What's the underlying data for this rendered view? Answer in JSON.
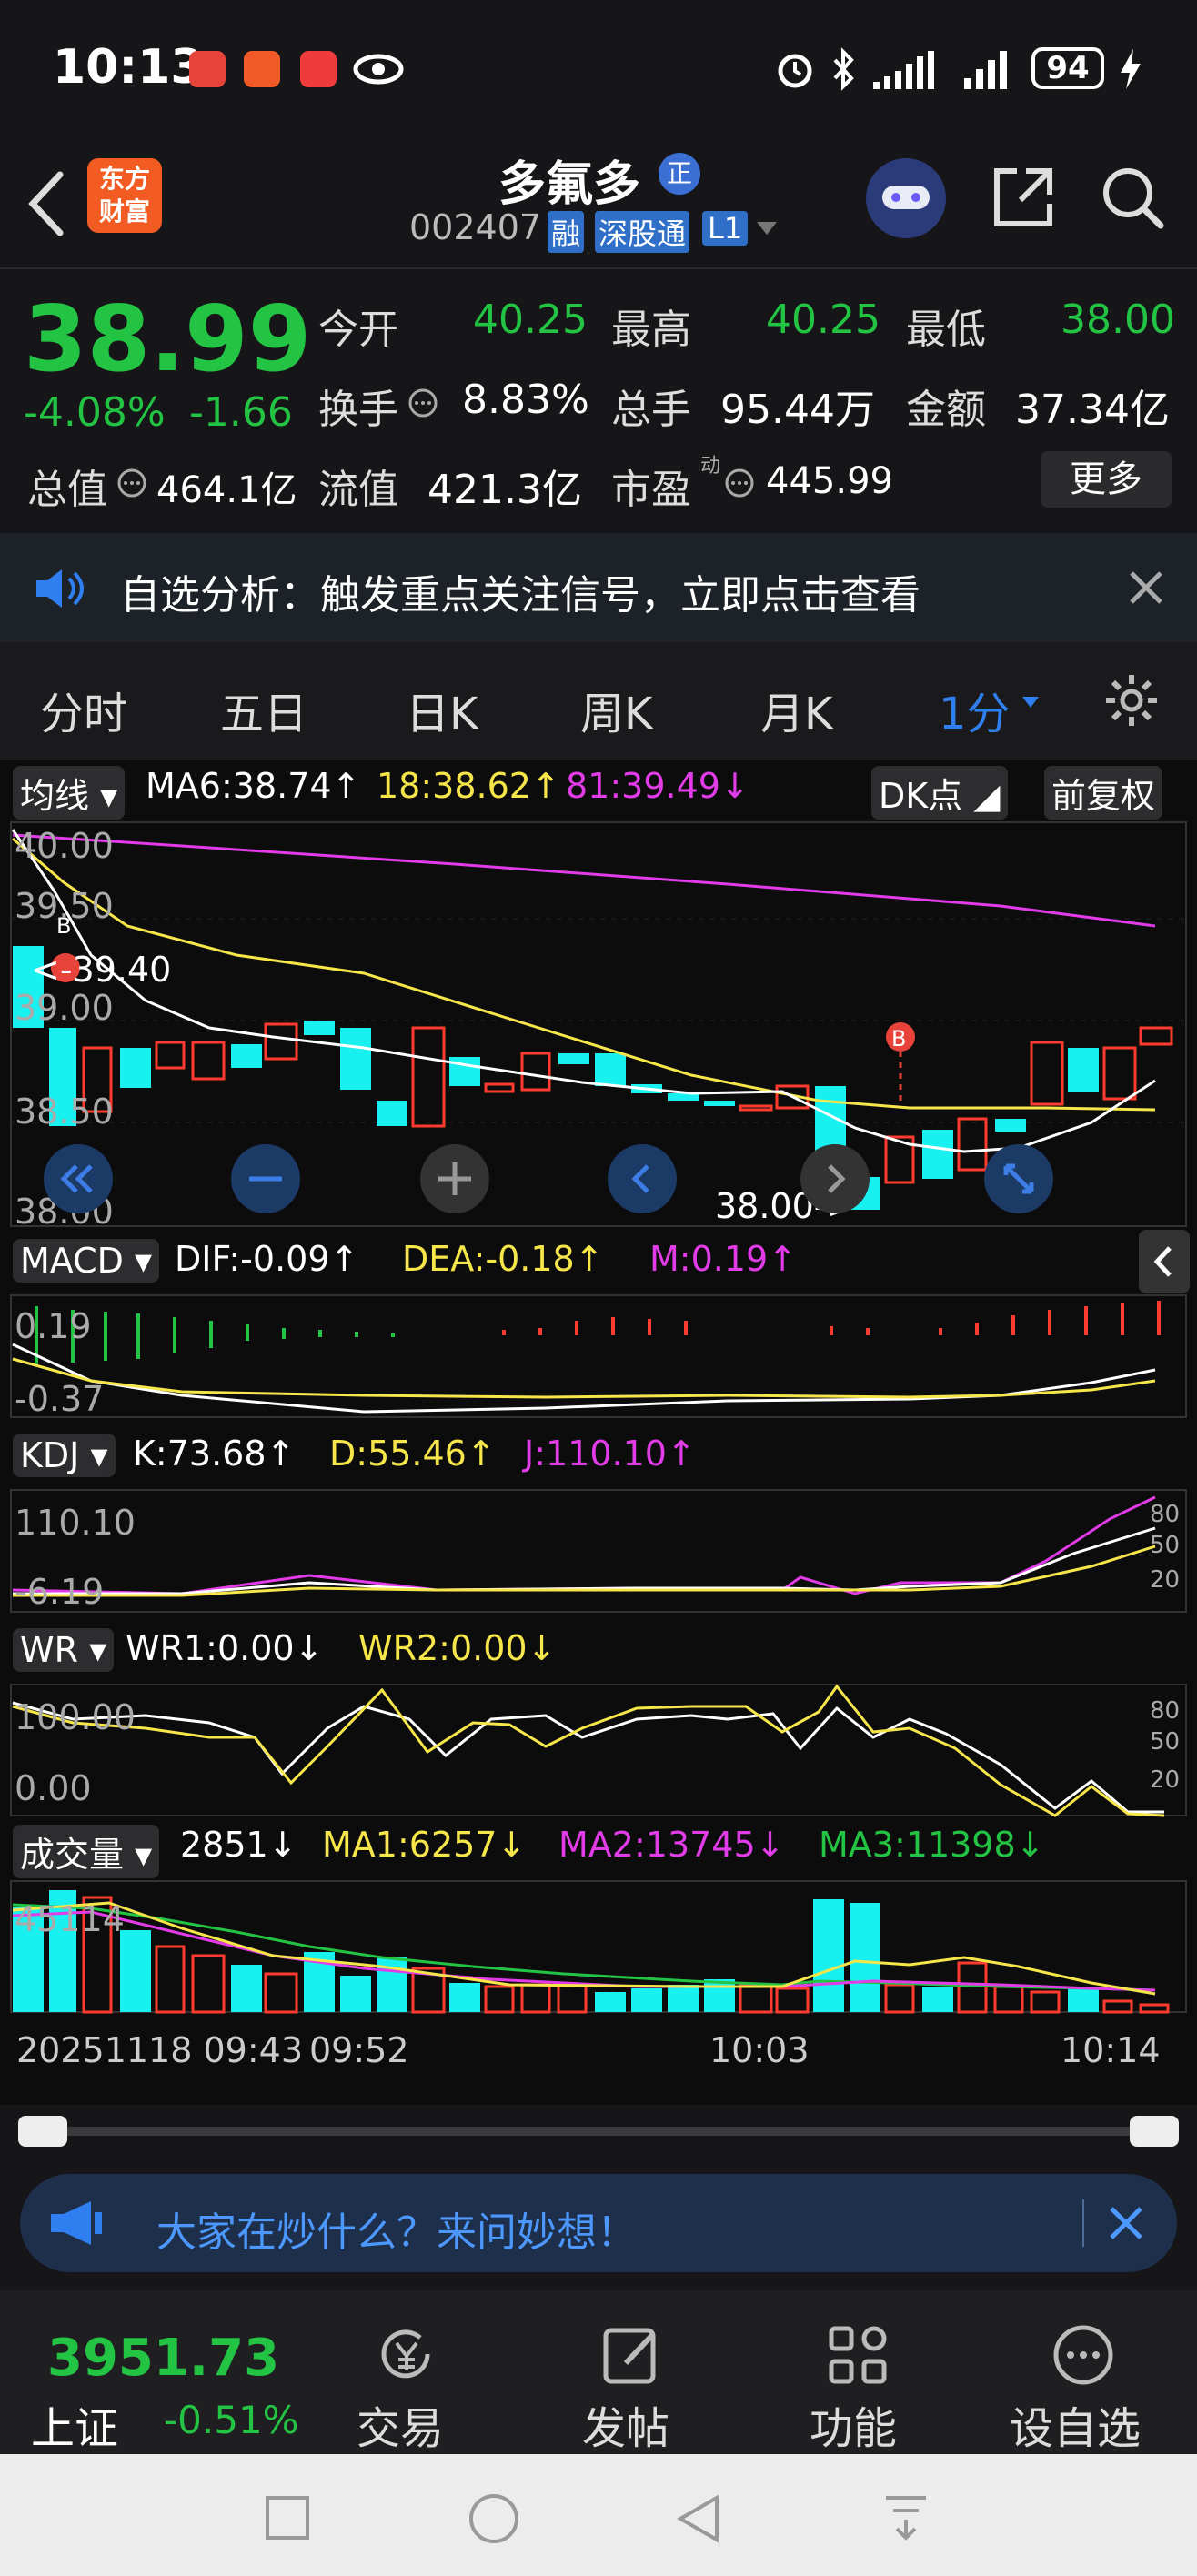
{
  "status_bar": {
    "time": "10:13",
    "battery": "94"
  },
  "header": {
    "logo_text": "东方财富",
    "stock_name": "多氟多",
    "stock_badge": "正",
    "stock_code": "002407",
    "tags": [
      "融",
      "深股通",
      "L1"
    ]
  },
  "quote": {
    "price": "38.99",
    "change_pct": "-4.08%",
    "change_amt": "-1.66",
    "open_label": "今开",
    "open": "40.25",
    "high_label": "最高",
    "high": "40.25",
    "low_label": "最低",
    "low": "38.00",
    "turnover_label": "换手",
    "turnover": "8.83%",
    "volume_label": "总手",
    "volume": "95.44万",
    "amount_label": "金额",
    "amount": "37.34亿",
    "total_mv_label": "总值",
    "total_mv": "464.1亿",
    "float_mv_label": "流值",
    "float_mv": "421.3亿",
    "pe_label": "市盈",
    "pe_sup": "动",
    "pe": "445.99",
    "more_label": "更多"
  },
  "notice": {
    "text": "自选分析：触发重点关注信号，立即点击查看"
  },
  "tabs": [
    "分时",
    "五日",
    "日K",
    "周K",
    "月K",
    "1分"
  ],
  "main_chart": {
    "indicator": "均线",
    "ma6": "MA6:38.74↑",
    "ma18": "18:38.62↑",
    "ma81": "81:39.49↓",
    "dk_label": "DK点",
    "adjust_label": "前复权",
    "y_labels": [
      "40.00",
      "39.50",
      "39.00",
      "38.50",
      "38.00"
    ],
    "high_marker": "<-39.40",
    "low_marker": "38.00->",
    "b_marker": "B"
  },
  "macd": {
    "name": "MACD",
    "dif": "DIF:-0.09↑",
    "dea": "DEA:-0.18↑",
    "m": "M:0.19↑",
    "y_labels": [
      "0.19",
      "-0.37"
    ]
  },
  "kdj": {
    "name": "KDJ",
    "k": "K:73.68↑",
    "d": "D:55.46↑",
    "j": "J:110.10↑",
    "y_labels": [
      "110.10",
      "-6.19"
    ],
    "levels": [
      "80",
      "50",
      "20"
    ]
  },
  "wr": {
    "name": "WR",
    "wr1": "WR1:0.00↓",
    "wr2": "WR2:0.00↓",
    "y_labels": [
      "100.00",
      "0.00"
    ],
    "levels": [
      "80",
      "50",
      "20"
    ]
  },
  "volume": {
    "name": "成交量",
    "value": "2851↓",
    "ma1": "MA1:6257↓",
    "ma2": "MA2:13745↓",
    "ma3": "MA3:11398↓",
    "y_label": "45114"
  },
  "time_axis": [
    "20251118 09:43",
    "09:52",
    "10:03",
    "10:14"
  ],
  "ad_bar": {
    "text": "大家在炒什么？来问妙想！"
  },
  "bottom_nav": {
    "index_value": "3951.73",
    "index_name": "上证",
    "index_change": "-0.51%",
    "items": [
      "交易",
      "发帖",
      "功能",
      "设自选"
    ]
  },
  "colors": {
    "up": "#ff3b30",
    "down": "#23c343",
    "accent": "#2f7ff0",
    "ma6": "#ffffff",
    "ma18": "#f6e64a",
    "ma81": "#e23be8"
  }
}
